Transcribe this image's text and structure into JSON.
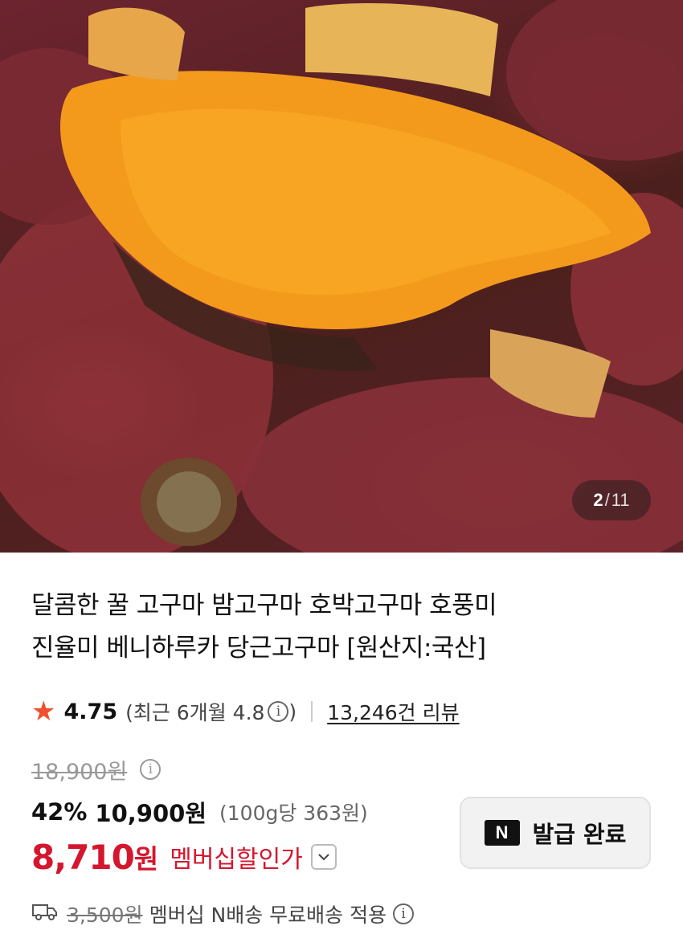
{
  "image_counter": {
    "current": "2",
    "separator": "/",
    "total": "11"
  },
  "product": {
    "title_line1": "달콤한 꿀 고구마 밤고구마 호박고구마 호풍미",
    "title_line2": "진율미 베니하루카 당근고구마 [원산지:국산]"
  },
  "rating": {
    "score": "4.75",
    "recent_label": "(최근 6개월 4.8",
    "recent_close": ")",
    "review_count": "13,246건 리뷰"
  },
  "price": {
    "original": "18,900원",
    "discount_rate": "42%",
    "sale_price": "10,900원",
    "unit_price": "(100g당 363원)",
    "member_price": "8,710",
    "member_price_unit": "원",
    "member_label": "멤버십할인가"
  },
  "coupon": {
    "badge": "N",
    "label": "발급 완료"
  },
  "shipping": {
    "original_fee": "3,500원",
    "description": "멤버십 N배송 무료배송 적용"
  },
  "icons": {
    "rating": "star-icon",
    "info": "info-icon",
    "expand": "chevron-down-icon",
    "shipping": "truck-icon"
  },
  "colors": {
    "accent_red": "#d4172e",
    "star": "#f0502d"
  }
}
